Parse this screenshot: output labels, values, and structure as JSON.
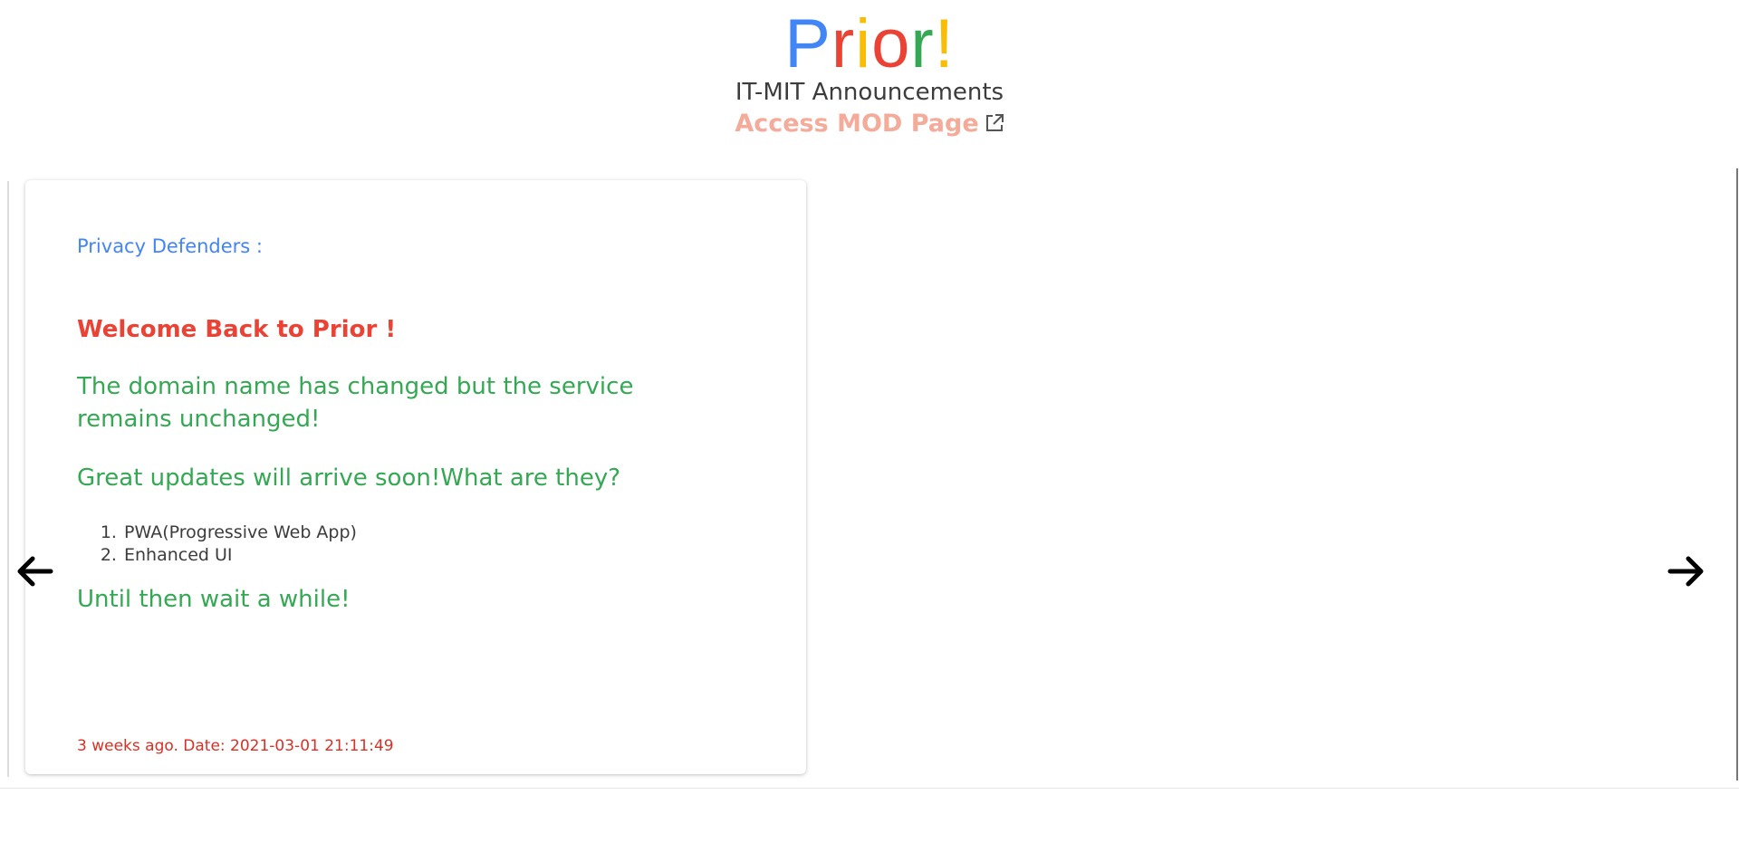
{
  "header": {
    "logo": {
      "letters": [
        {
          "char": "P",
          "color": "#4285f4"
        },
        {
          "char": "r",
          "color": "#ea4335"
        },
        {
          "char": "i",
          "color": "#fbbc05"
        },
        {
          "char": "o",
          "color": "#ea4335"
        },
        {
          "char": "r",
          "color": "#34a853"
        },
        {
          "char": "!",
          "color": "#fbbc05"
        }
      ]
    },
    "subtitle": "IT-MIT Announcements",
    "mod_link": {
      "label": "Access MOD Page",
      "icon": "external-link-icon"
    }
  },
  "carousel": {
    "prev_icon": "arrow-left-icon",
    "next_icon": "arrow-right-icon",
    "card": {
      "heading": "Privacy Defenders :",
      "welcome": "Welcome Back to Prior !",
      "paragraphs": [
        "The domain name has changed but the service remains unchanged!",
        "Great updates will arrive soon!What are they?",
        "Until then wait a while!"
      ],
      "list": [
        "PWA(Progressive Web App)",
        "Enhanced UI"
      ],
      "date": "3 weeks ago. Date: 2021-03-01 21:11:49"
    }
  },
  "colors": {
    "blue": "#4285f4",
    "red": "#ea4335",
    "yellow": "#fbbc05",
    "green": "#34a853",
    "link": "#f4ab9a",
    "date_red": "#d93025"
  }
}
